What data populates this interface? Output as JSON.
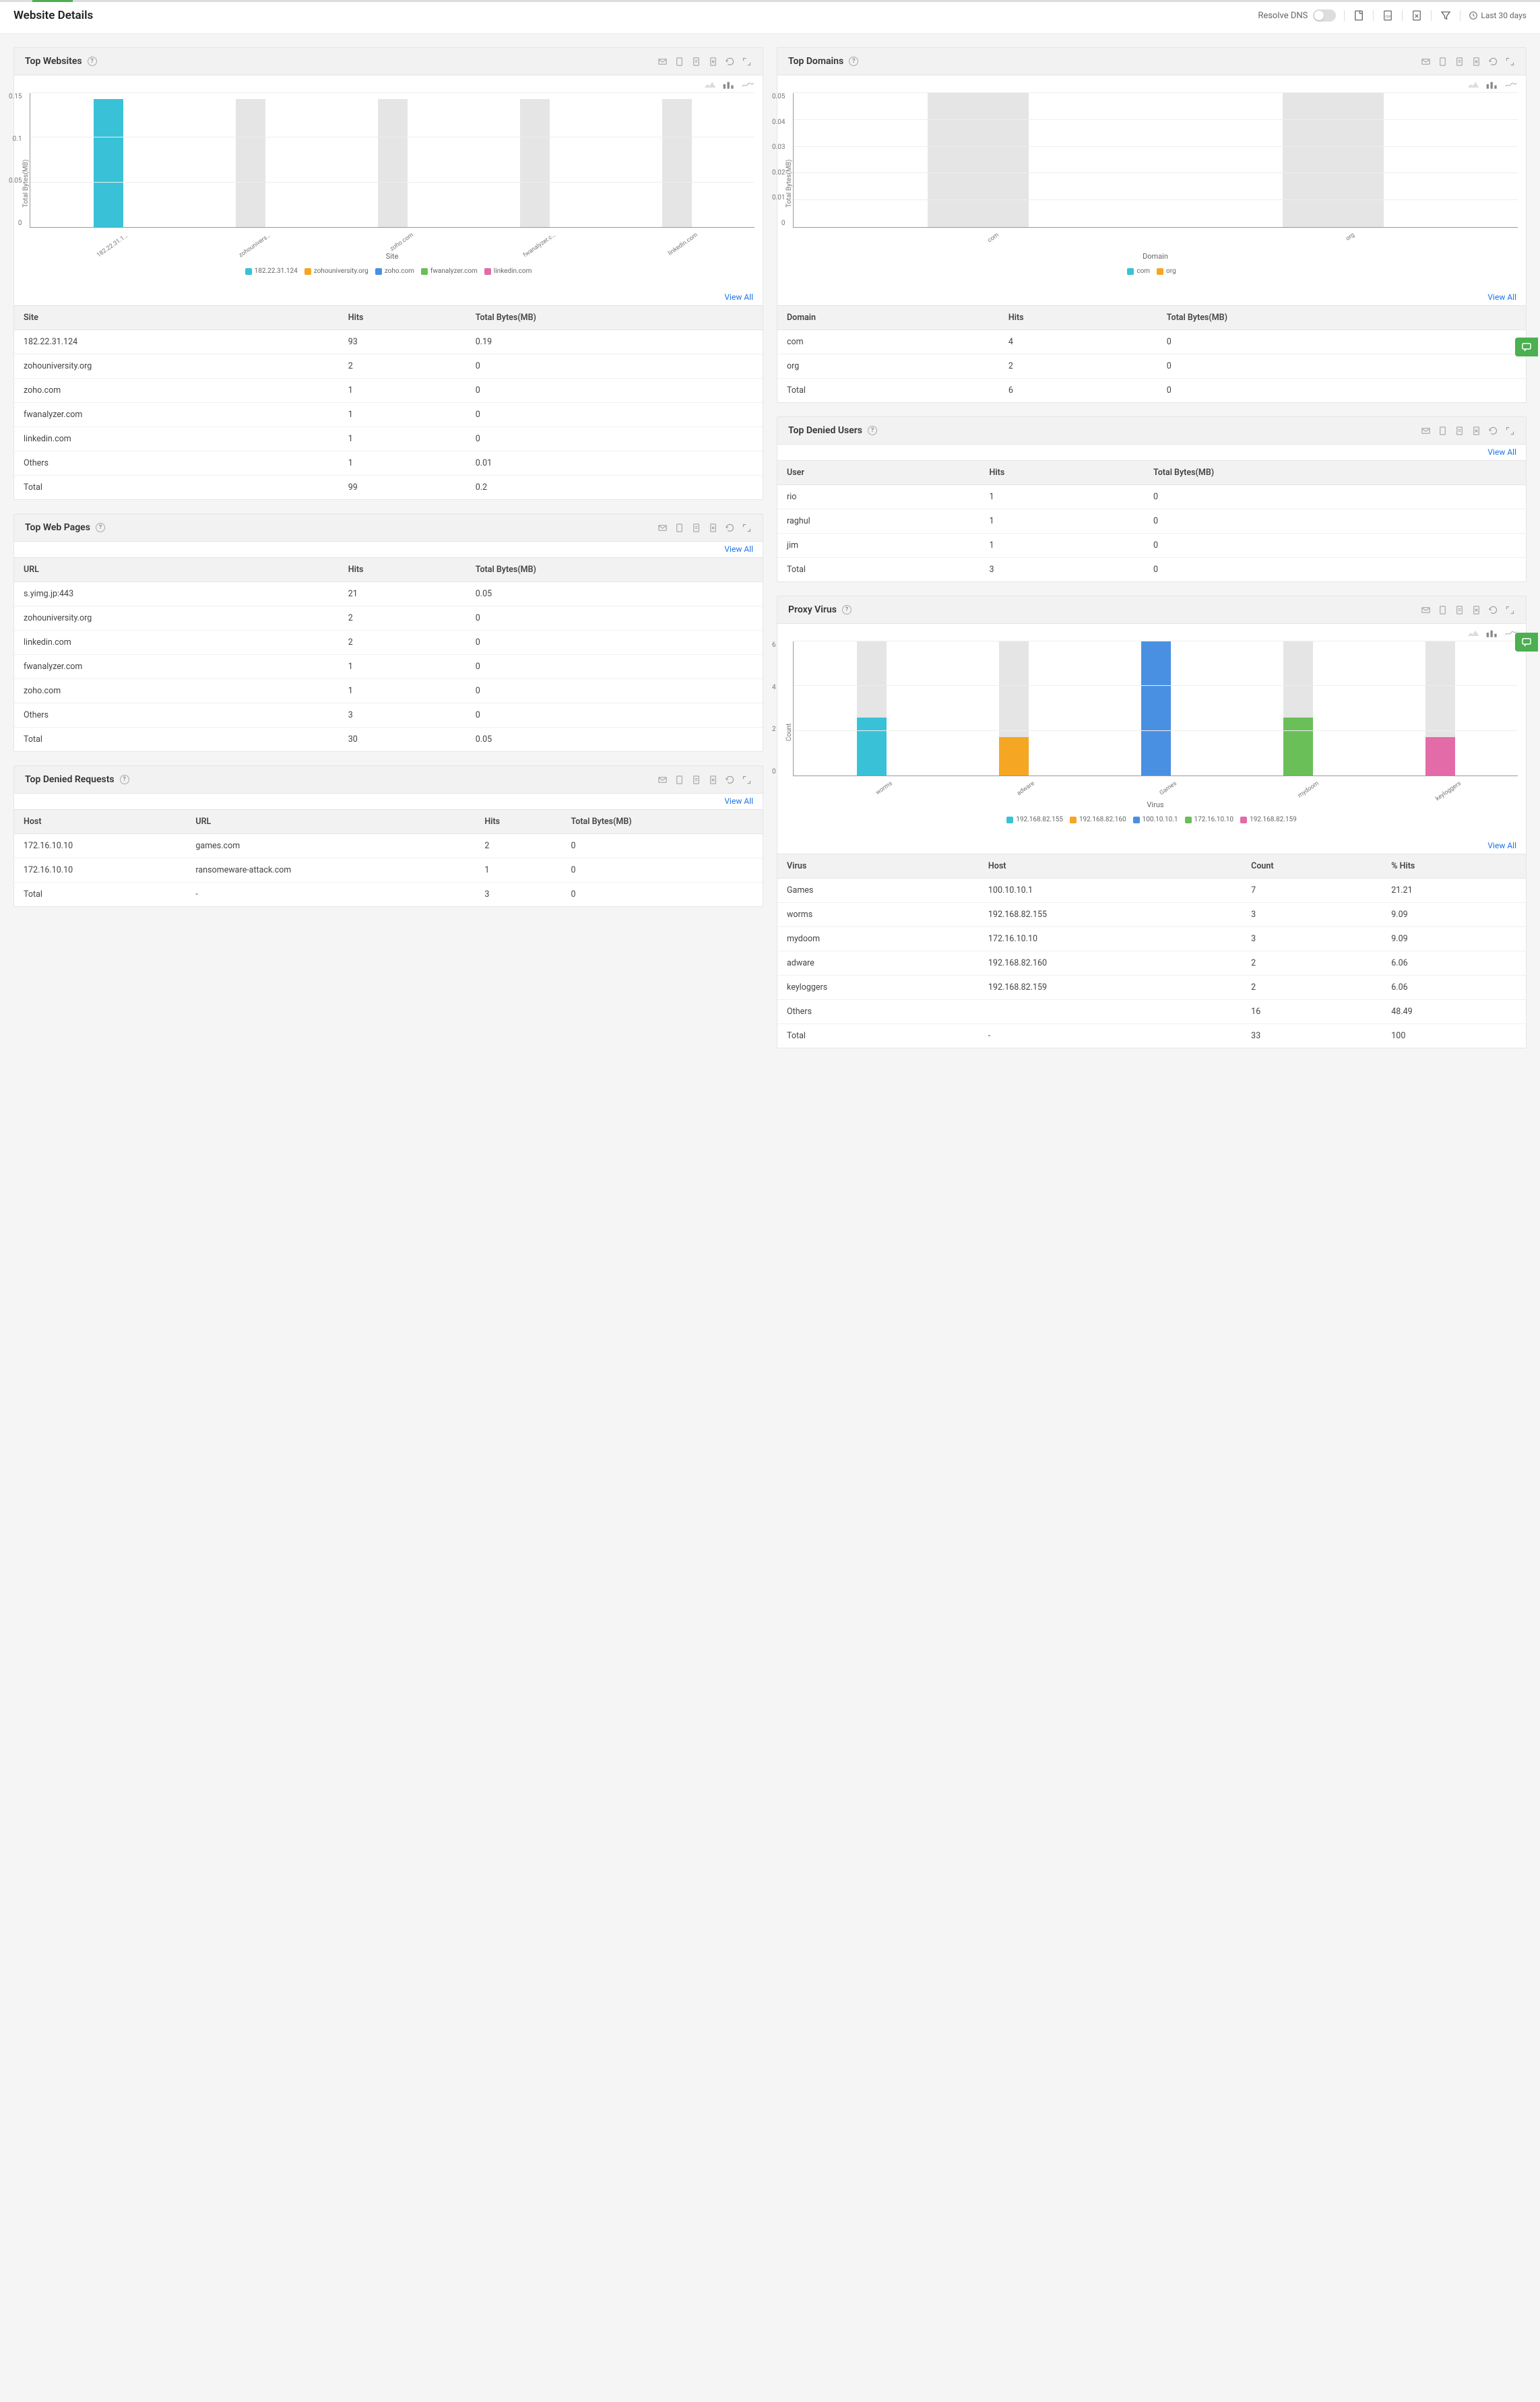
{
  "page_title": "Website Details",
  "header": {
    "resolve_dns": "Resolve DNS",
    "time_range": "Last 30 days"
  },
  "common": {
    "view_all": "View All"
  },
  "chart_data": [
    {
      "id": "top_websites",
      "type": "bar",
      "title": "Top Websites",
      "xlabel": "Site",
      "ylabel": "Total Bytes(MB)",
      "ylim": [
        0,
        0.2
      ],
      "y_ticks": [
        "0",
        "0.05",
        "0.1",
        "0.15"
      ],
      "categories": [
        "182.22.31.124",
        "zohouniversity.org",
        "zoho.com",
        "fwanalyzer.com",
        "linkedin.com"
      ],
      "values": [
        0.19,
        0,
        0,
        0,
        0
      ],
      "colors": [
        "#39c2d7",
        "#f5a623",
        "#4a90e2",
        "#6bbf59",
        "#e36ba8"
      ],
      "ghost_height": 0.19,
      "legend": [
        "182.22.31.124",
        "zohouniversity.org",
        "zoho.com",
        "fwanalyzer.com",
        "linkedin.com"
      ]
    },
    {
      "id": "top_domains",
      "type": "bar",
      "title": "Top Domains",
      "xlabel": "Domain",
      "ylabel": "Total Bytes(MB)",
      "ylim": [
        0,
        0.05
      ],
      "y_ticks": [
        "0",
        "0.01",
        "0.02",
        "0.03",
        "0.04",
        "0.05"
      ],
      "categories": [
        "com",
        "org"
      ],
      "values": [
        0,
        0
      ],
      "colors": [
        "#39c2d7",
        "#f5a623"
      ],
      "ghost_height": 0.05,
      "legend": [
        "com",
        "org"
      ]
    },
    {
      "id": "proxy_virus",
      "type": "bar",
      "title": "Proxy Virus",
      "xlabel": "Virus",
      "ylabel": "Count",
      "ylim": [
        0,
        7
      ],
      "y_ticks": [
        "0",
        "2",
        "4",
        "6"
      ],
      "categories": [
        "worms",
        "adware",
        "Games",
        "mydoom",
        "keyloggers"
      ],
      "values": [
        3,
        2,
        7,
        3,
        2
      ],
      "colors": [
        "#39c2d7",
        "#f5a623",
        "#4a90e2",
        "#6bbf59",
        "#e36ba8"
      ],
      "ghost_height": 7,
      "legend": [
        "192.168.82.155",
        "192.168.82.160",
        "100.10.10.1",
        "172.16.10.10",
        "192.168.82.159"
      ]
    }
  ],
  "cards": {
    "top_websites": {
      "title": "Top Websites",
      "columns": [
        "Site",
        "Hits",
        "Total Bytes(MB)"
      ],
      "rows": [
        {
          "c0": "182.22.31.124",
          "c1": "93",
          "c2": "0.19",
          "link": true
        },
        {
          "c0": "zohouniversity.org",
          "c1": "2",
          "c2": "0",
          "link": true
        },
        {
          "c0": "zoho.com",
          "c1": "1",
          "c2": "0",
          "link": true
        },
        {
          "c0": "fwanalyzer.com",
          "c1": "1",
          "c2": "0",
          "link": true
        },
        {
          "c0": "linkedin.com",
          "c1": "1",
          "c2": "0",
          "link": true
        },
        {
          "c0": "Others",
          "c1": "1",
          "c2": "0.01",
          "link": false
        },
        {
          "c0": "Total",
          "c1": "99",
          "c2": "0.2",
          "link": false
        }
      ]
    },
    "top_web_pages": {
      "title": "Top Web Pages",
      "columns": [
        "URL",
        "Hits",
        "Total Bytes(MB)"
      ],
      "rows": [
        {
          "c0": "s.yimg.jp:443",
          "c1": "21",
          "c2": "0.05",
          "link": false
        },
        {
          "c0": "zohouniversity.org",
          "c1": "2",
          "c2": "0",
          "link": false
        },
        {
          "c0": "linkedin.com",
          "c1": "2",
          "c2": "0",
          "link": false
        },
        {
          "c0": "fwanalyzer.com",
          "c1": "1",
          "c2": "0",
          "link": false
        },
        {
          "c0": "zoho.com",
          "c1": "1",
          "c2": "0",
          "link": false
        },
        {
          "c0": "Others",
          "c1": "3",
          "c2": "0",
          "link": false
        },
        {
          "c0": "Total",
          "c1": "30",
          "c2": "0.05",
          "link": false
        }
      ]
    },
    "top_denied_requests": {
      "title": "Top Denied Requests",
      "columns": [
        "Host",
        "URL",
        "Hits",
        "Total Bytes(MB)"
      ],
      "rows": [
        {
          "c0": "172.16.10.10",
          "c1": "games.com",
          "c2": "2",
          "c3": "0"
        },
        {
          "c0": "172.16.10.10",
          "c1": "ransomeware-attack.com",
          "c2": "1",
          "c3": "0"
        },
        {
          "c0": "Total",
          "c1": "-",
          "c2": "3",
          "c3": "0"
        }
      ]
    },
    "top_domains": {
      "title": "Top Domains",
      "columns": [
        "Domain",
        "Hits",
        "Total Bytes(MB)"
      ],
      "rows": [
        {
          "c0": "com",
          "c1": "4",
          "c2": "0",
          "link": true
        },
        {
          "c0": "org",
          "c1": "2",
          "c2": "0",
          "link": true
        },
        {
          "c0": "Total",
          "c1": "6",
          "c2": "0",
          "link": false
        }
      ]
    },
    "top_denied_users": {
      "title": "Top Denied Users",
      "columns": [
        "User",
        "Hits",
        "Total Bytes(MB)"
      ],
      "rows": [
        {
          "c0": "rio",
          "c1": "1",
          "c2": "0",
          "link": true
        },
        {
          "c0": "raghul",
          "c1": "1",
          "c2": "0",
          "link": true
        },
        {
          "c0": "jim",
          "c1": "1",
          "c2": "0",
          "link": true
        },
        {
          "c0": "Total",
          "c1": "3",
          "c2": "0",
          "link": false
        }
      ]
    },
    "proxy_virus": {
      "title": "Proxy Virus",
      "columns": [
        "Virus",
        "Host",
        "Count",
        "% Hits"
      ],
      "rows": [
        {
          "c0": "Games",
          "c1": "100.10.10.1",
          "c2": "7",
          "c3": "21.21",
          "link": true
        },
        {
          "c0": "worms",
          "c1": "192.168.82.155",
          "c2": "3",
          "c3": "9.09",
          "link": true
        },
        {
          "c0": "mydoom",
          "c1": "172.16.10.10",
          "c2": "3",
          "c3": "9.09",
          "link": true
        },
        {
          "c0": "adware",
          "c1": "192.168.82.160",
          "c2": "2",
          "c3": "6.06",
          "link": true
        },
        {
          "c0": "keyloggers",
          "c1": "192.168.82.159",
          "c2": "2",
          "c3": "6.06",
          "link": true
        },
        {
          "c0": "Others",
          "c1": "",
          "c2": "16",
          "c3": "48.49",
          "link": false
        },
        {
          "c0": "Total",
          "c1": "-",
          "c2": "33",
          "c3": "100",
          "link": false
        }
      ]
    }
  }
}
